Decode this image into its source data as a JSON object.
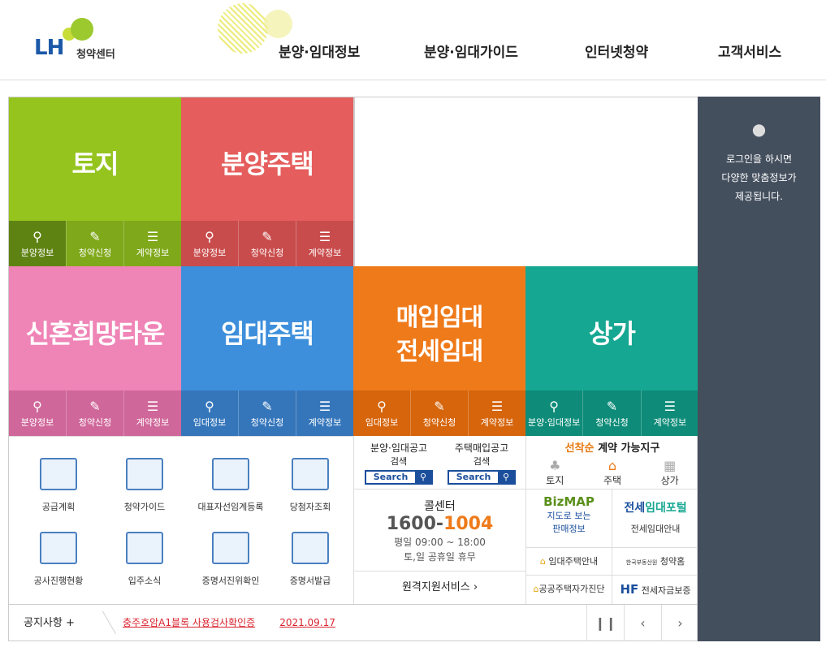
{
  "header": {
    "logo_mark": "LH",
    "logo_text": "청약센터",
    "nav": [
      "분양·임대정보",
      "분양·임대가이드",
      "인터넷청약",
      "고객서비스"
    ]
  },
  "tiles": [
    {
      "title": "토지",
      "subs": [
        "분양정보",
        "청약신청",
        "계약정보"
      ]
    },
    {
      "title": "분양주택",
      "subs": [
        "분양정보",
        "청약신청",
        "계약정보"
      ]
    },
    {
      "title": "신혼희망타운",
      "subs": [
        "분양정보",
        "청약신청",
        "계약정보"
      ]
    },
    {
      "title": "임대주택",
      "subs": [
        "임대정보",
        "청약신청",
        "계약정보"
      ]
    },
    {
      "title_line1": "매입임대",
      "title_line2": "전세임대",
      "subs": [
        "임대정보",
        "청약신청",
        "계약정보"
      ]
    },
    {
      "title": "상가",
      "subs": [
        "분양·임대정보",
        "청약신청",
        "계약정보"
      ]
    }
  ],
  "quick": [
    "공급계획",
    "청약가이드",
    "대표자선임계등록",
    "당첨자조회",
    "공사진행현황",
    "입주소식",
    "증명서진위확인",
    "증명서발급"
  ],
  "search": {
    "left_title": "분양·임대공고",
    "left_sub": "검색",
    "right_title": "주택매입공고",
    "right_sub": "검색",
    "btn": "Search"
  },
  "call": {
    "label": "콜센터",
    "num1": "1600-",
    "num2": "1004",
    "hours": "평일 09:00 ~ 18:00",
    "holiday": "토,일 공휴일 휴무"
  },
  "remote": "원격지원서비스",
  "contract": {
    "title_highlight": "선착순",
    "title_rest": "계약 가능지구",
    "items": [
      "토지",
      "주택",
      "상가"
    ]
  },
  "banners": {
    "bizmap_logo": "BizMAP",
    "bizmap_sub1": "지도로 보는",
    "bizmap_sub2": "판매정보",
    "portal_a": "전세",
    "portal_b": "임대포털",
    "portal_sub": "전세임대안내",
    "rent": "임대주택안내",
    "apply_org": "한국부동산원",
    "apply_name": "청약홈",
    "selfcheck": "공공주택자가진단",
    "hf": "전세자금보증"
  },
  "notice": {
    "label": "공지사항",
    "text": "충주호암A1블록 사용검사확인증",
    "date": "2021.09.17"
  },
  "side": {
    "line1": "로그인을 하시면",
    "line2": "다양한 맞춤정보가",
    "line3": "제공됩니다."
  },
  "colors": {
    "green": "#95c41f",
    "red": "#e55d5d",
    "pink": "#ef84b6",
    "blue": "#3e8fdb",
    "orange": "#ef7a1a",
    "teal": "#16a792"
  }
}
